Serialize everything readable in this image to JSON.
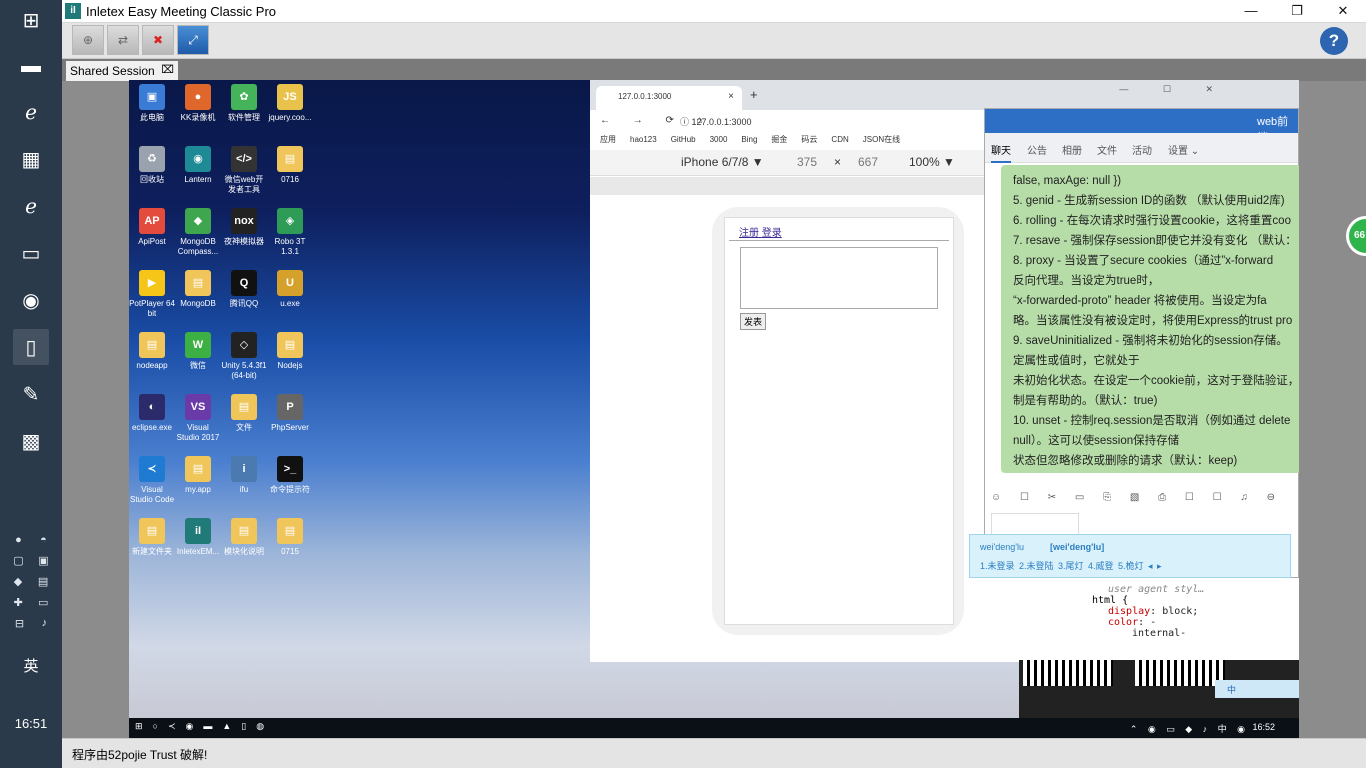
{
  "app": {
    "title": "Inletex Easy Meeting Classic Pro",
    "icon_letter": "iI",
    "help_label": "?",
    "status": "程序由52pojie Trust 破解!"
  },
  "session_tab": {
    "label": "Shared Session",
    "close": "⌧"
  },
  "local_taskbar": {
    "ime_lang": "英",
    "clock": "16:51"
  },
  "remote_desktop": {
    "icons": [
      {
        "label": "此电脑",
        "color": "#3a7bd5",
        "glyph": "▣"
      },
      {
        "label": "KK录像机",
        "color": "#e0672b",
        "glyph": "●"
      },
      {
        "label": "软件管理",
        "color": "#44b35a",
        "glyph": "✿"
      },
      {
        "label": "jquery.coo...",
        "color": "#e8c24a",
        "glyph": "JS"
      },
      {
        "label": "回收站",
        "color": "#9aa3ad",
        "glyph": "♻"
      },
      {
        "label": "Lantern",
        "color": "#1d8a95",
        "glyph": "◉"
      },
      {
        "label": "微信web开发者工具",
        "color": "#333",
        "glyph": "</>"
      },
      {
        "label": "0716",
        "color": "#f0c65a",
        "glyph": "▤"
      },
      {
        "label": "ApiPost",
        "color": "#e54b3c",
        "glyph": "AP"
      },
      {
        "label": "MongoDB Compass...",
        "color": "#3ea64e",
        "glyph": "◆"
      },
      {
        "label": "夜神模拟器",
        "color": "#222",
        "glyph": "nox"
      },
      {
        "label": "Robo 3T 1.3.1",
        "color": "#2e9c57",
        "glyph": "◈"
      },
      {
        "label": "PotPlayer 64 bit",
        "color": "#f5c518",
        "glyph": "▶"
      },
      {
        "label": "MongoDB",
        "color": "#f0c65a",
        "glyph": "▤"
      },
      {
        "label": "腾讯QQ",
        "color": "#111",
        "glyph": "Q"
      },
      {
        "label": "u.exe",
        "color": "#d6a12b",
        "glyph": "U"
      },
      {
        "label": "nodeapp",
        "color": "#f0c65a",
        "glyph": "▤"
      },
      {
        "label": "微信",
        "color": "#3cb043",
        "glyph": "W"
      },
      {
        "label": "Unity 5.4.3f1 (64-bit)",
        "color": "#222",
        "glyph": "◇"
      },
      {
        "label": "Nodejs",
        "color": "#f0c65a",
        "glyph": "▤"
      },
      {
        "label": "eclipse.exe",
        "color": "#2b2a6b",
        "glyph": "◐"
      },
      {
        "label": "Visual Studio 2017",
        "color": "#6a3aa8",
        "glyph": "VS"
      },
      {
        "label": "文件",
        "color": "#f0c65a",
        "glyph": "▤"
      },
      {
        "label": "PhpServer",
        "color": "#666",
        "glyph": "P"
      },
      {
        "label": "Visual Studio Code",
        "color": "#1f7ad1",
        "glyph": "≺"
      },
      {
        "label": "my.app",
        "color": "#f0c65a",
        "glyph": "▤"
      },
      {
        "label": "ifu",
        "color": "#4a7ab0",
        "glyph": "i"
      },
      {
        "label": "命令提示符",
        "color": "#111",
        "glyph": ">_"
      },
      {
        "label": "新建文件夹",
        "color": "#f0c65a",
        "glyph": "▤"
      },
      {
        "label": "InletexEM...",
        "color": "#1f7a78",
        "glyph": "iI"
      },
      {
        "label": "模块化说明",
        "color": "#f0c65a",
        "glyph": "▤"
      },
      {
        "label": "0715",
        "color": "#f0c65a",
        "glyph": "▤"
      }
    ],
    "taskbar_clock": "16:52",
    "tray_text": "中"
  },
  "browser": {
    "tab_title": "127.0.0.1:3000",
    "tab_close": "×",
    "new_tab": "+",
    "nav": "← → ⟳ ⌂",
    "url": "ⓘ 127.0.0.1:3000",
    "win_buttons": "— ☐ ✕",
    "bookmarks": [
      "应用",
      "hao123",
      "GitHub",
      "3000",
      "Bing",
      "掘金",
      "码云",
      "CDN",
      "JSON在线"
    ],
    "device": "iPhone 6/7/8 ▼",
    "width": "375",
    "times": "×",
    "height": "667",
    "zoom": "100% ▼",
    "page_links": [
      "注册",
      "登录"
    ],
    "submit_label": "发表"
  },
  "chat": {
    "title": "web前端",
    "tabs": [
      "聊天",
      "公告",
      "相册",
      "文件",
      "活动",
      "设置 ⌄"
    ],
    "lines": [
      "false, maxAge: null })",
      "5. genid - 生成新session ID的函数 （默认使用uid2库)",
      "6. rolling - 在每次请求时强行设置cookie，这将重置coo",
      "7. resave - 强制保存session即使它并没有变化 （默认：",
      "8. proxy - 当设置了secure cookies（通过”x-forward",
      "反向代理。当设定为true时，",
      "“x-forwarded-proto” header 将被使用。当设定为fa",
      "略。当该属性没有被设定时，将使用Express的trust pro",
      "9. saveUninitialized - 强制将未初始化的session存储。",
      "定属性或值时，它就处于",
      "未初始化状态。在设定一个cookie前，这对于登陆验证，",
      "制是有帮助的。（默认：true)",
      "10. unset - 控制req.session是否取消（例如通过 delete",
      "null）。这可以使session保持存储",
      "状态但忽略修改或删除的请求（默认：keep)"
    ],
    "toolbar": "☺ ☐ ✂ ▭ ⎘ ▧ ⎙ ☐ ☐ ♫ ⊖"
  },
  "ime": {
    "pinyin": "wei'deng'lu",
    "pinyin_hint": "[wei'deng'lu]",
    "candidates": "1.未登录  2.未登陆  3.尾灯  4.威登  5.桅灯  ◂ ▸"
  },
  "devtools": {
    "ua": "user agent styl…",
    "selector": "html {",
    "prop1": "display",
    "val1": ": block;",
    "prop2": "color",
    "val2": ": -",
    "val3": "internal-"
  },
  "edge_badge": "66"
}
